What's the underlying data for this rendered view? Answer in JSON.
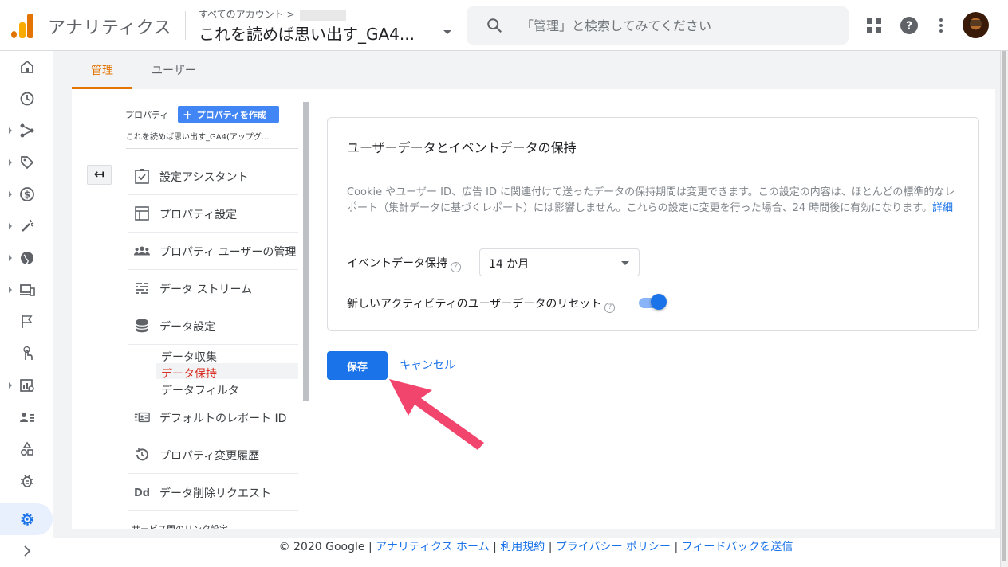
{
  "header": {
    "app_title": "アナリティクス",
    "account_crumb": "すべてのアカウント >",
    "property_name": "これを読めば思い出す_GA4...",
    "search_placeholder": "「管理」と検索してみてください"
  },
  "tabs": [
    {
      "label": "管理",
      "active": true
    },
    {
      "label": "ユーザー",
      "active": false
    }
  ],
  "property_column": {
    "label": "プロパティ",
    "create_button": "プロパティを作成",
    "create_plus": "+",
    "selected_property": "これを読めば思い出す_GA4(アップグ...",
    "back_glyph": "↤",
    "items": [
      {
        "label": "設定アシスタント",
        "icon": "checklist-icon"
      },
      {
        "label": "プロパティ設定",
        "icon": "property-settings-icon"
      },
      {
        "label": "プロパティ ユーザーの管理",
        "icon": "people-icon"
      },
      {
        "label": "データ ストリーム",
        "icon": "data-stream-icon"
      },
      {
        "label": "データ設定",
        "icon": "database-icon"
      }
    ],
    "sub_items": [
      {
        "label": "データ収集",
        "active": false
      },
      {
        "label": "データ保持",
        "active": true
      },
      {
        "label": "データフィルタ",
        "active": false
      }
    ],
    "items_after": [
      {
        "label": "デフォルトのレポート ID",
        "icon": "report-id-icon"
      },
      {
        "label": "プロパティ変更履歴",
        "icon": "history-icon"
      },
      {
        "label": "データ削除リクエスト",
        "icon": "dd-icon"
      }
    ],
    "cut_item": "サービス間のリンク設定"
  },
  "card": {
    "title": "ユーザーデータとイベントデータの保持",
    "description": "Cookie やユーザー ID、広告 ID に関連付けて送ったデータの保持期間は変更できます。この設定の内容は、ほとんどの標準的なレポート（集計データに基づくレポート）には影響しません。これらの設定に変更を行った場合、24 時間後に有効になります。",
    "more_link": "詳細",
    "event_retention_label": "イベントデータ保持",
    "event_retention_value": "14 か月",
    "reset_label": "新しいアクティビティのユーザーデータのリセット",
    "reset_enabled": true,
    "help_glyph": "?"
  },
  "actions": {
    "save": "保存",
    "cancel": "キャンセル"
  },
  "footer": {
    "copyright": "© 2020 Google",
    "sep": " | ",
    "links": [
      "アナリティクス ホーム",
      "利用規約",
      "プライバシー ポリシー",
      "フィードバックを送信"
    ]
  },
  "colors": {
    "accent_orange": "#e37400",
    "primary_blue": "#1a73e8",
    "active_red": "#d93025",
    "annotation_arrow": "#f2456e"
  }
}
